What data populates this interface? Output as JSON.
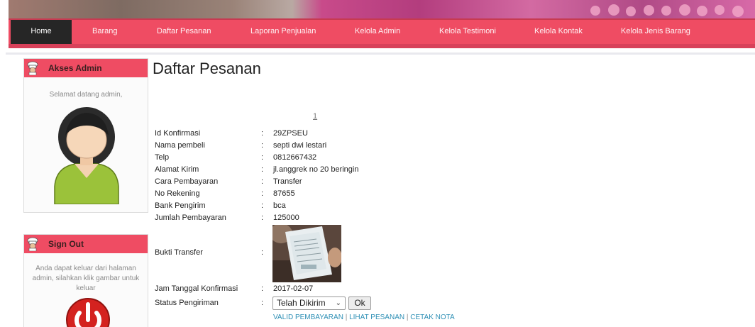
{
  "nav": {
    "items": [
      {
        "label": "Home"
      },
      {
        "label": "Barang"
      },
      {
        "label": "Daftar Pesanan"
      },
      {
        "label": "Laporan Penjualan"
      },
      {
        "label": "Kelola Admin"
      },
      {
        "label": "Kelola Testimoni"
      },
      {
        "label": "Kelola Kontak"
      },
      {
        "label": "Kelola Jenis Barang"
      }
    ]
  },
  "sidebar": {
    "admin": {
      "title": "Akses Admin",
      "welcome": "Selamat datang admin,",
      "avatar_icon": "admin-avatar-icon"
    },
    "signout": {
      "title": "Sign Out",
      "text": "Anda dapat keluar dari halaman admin, silahkan klik gambar untuk keluar",
      "icon": "power-icon"
    }
  },
  "main": {
    "title": "Daftar Pesanan",
    "page_number": "1",
    "fields": [
      {
        "label": "Id Konfirmasi",
        "value": "29ZPSEU"
      },
      {
        "label": "Nama pembeli",
        "value": "septi dwi lestari"
      },
      {
        "label": "Telp",
        "value": "0812667432"
      },
      {
        "label": "Alamat Kirim",
        "value": "jl.anggrek no 20 beringin"
      },
      {
        "label": "Cara Pembayaran",
        "value": "Transfer"
      },
      {
        "label": "No Rekening",
        "value": "87655"
      },
      {
        "label": "Bank Pengirim",
        "value": "bca"
      },
      {
        "label": "Jumlah Pembayaran",
        "value": "125000"
      }
    ],
    "proof": {
      "label": "Bukti Transfer"
    },
    "date": {
      "label": "Jam Tanggal Konfirmasi",
      "value": "2017-02-07"
    },
    "status": {
      "label": "Status Pengiriman",
      "selected": "Telah Dikirim",
      "ok_label": "Ok"
    },
    "colon": ":",
    "actions": {
      "valid": "VALID PEMBAYARAN",
      "view": "LIHAT PESANAN",
      "print": "CETAK NOTA",
      "separator": "|"
    }
  },
  "colors": {
    "accent": "#ef4c63",
    "nav_active": "#262626",
    "link": "#2d8fb5"
  }
}
